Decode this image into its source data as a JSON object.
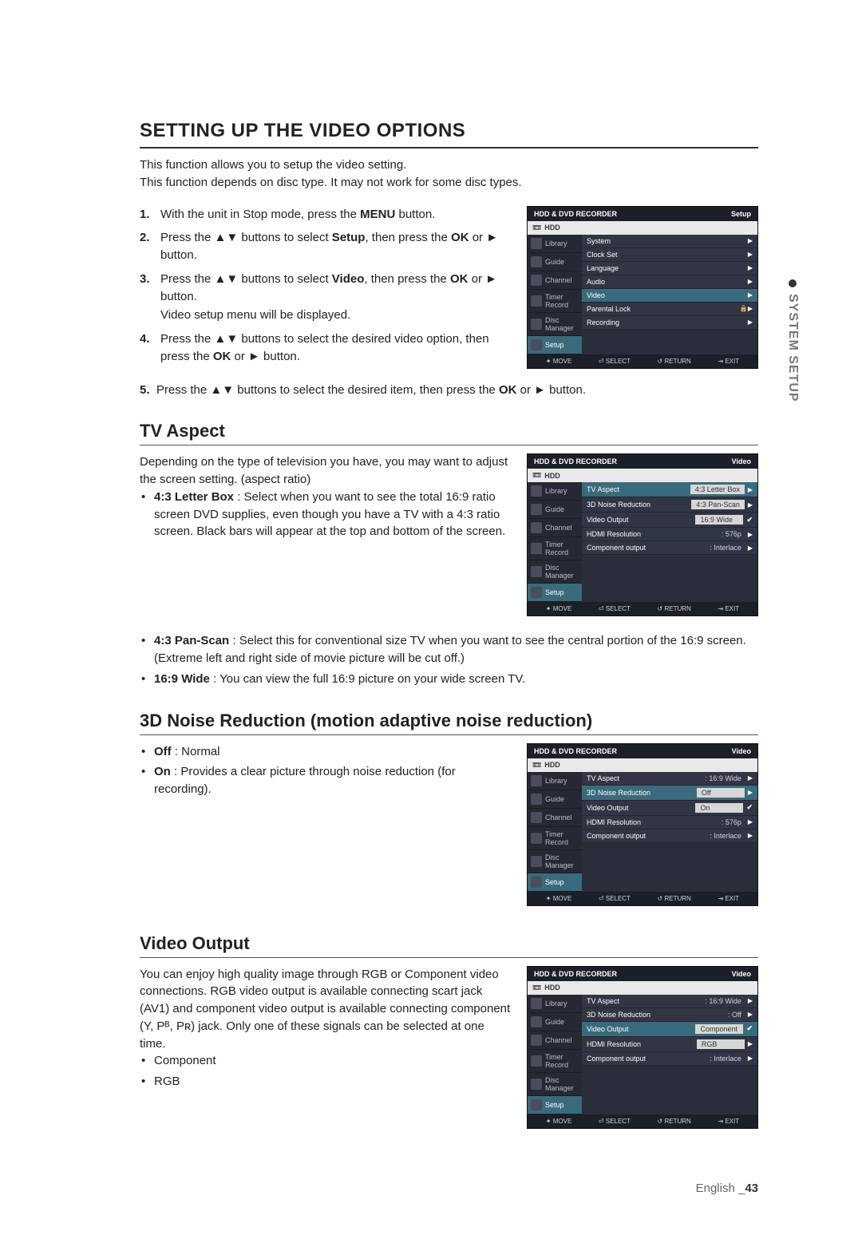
{
  "sideTab": "SYSTEM SETUP",
  "h1": "SETTING UP THE VIDEO OPTIONS",
  "intro1": "This function allows you to setup the video setting.",
  "intro2": "This function depends on disc type. It may not work for some disc types.",
  "steps": {
    "s1a": "With the unit in Stop mode, press the ",
    "s1b": "MENU",
    "s1c": " button.",
    "s2a": "Press the ▲▼ buttons to select ",
    "s2b": "Setup",
    "s2c": ", then press the ",
    "s2d": "OK",
    "s2e": " or ► button.",
    "s3a": "Press the ▲▼ buttons to select ",
    "s3b": "Video",
    "s3c": ", then press the ",
    "s3d": "OK",
    "s3e": " or ► button.",
    "s3sub": "Video setup menu will be displayed.",
    "s4a": "Press the ▲▼ buttons to select the desired video option, then press the ",
    "s4b": "OK",
    "s4c": " or ► button.",
    "s5a": "Press the ▲▼ buttons to select the desired item, then press the ",
    "s5b": "OK",
    "s5c": " or ► button."
  },
  "tvAspect": {
    "title": "TV Aspect",
    "desc": "Depending on the type of television you have, you may want to adjust the screen setting. (aspect ratio)",
    "lb_label": "4:3 Letter Box",
    "lb_text": " : Select when you want to see the total 16:9 ratio screen DVD supplies, even though you have a TV with a 4:3 ratio screen. Black bars will appear at the top and bottom of the screen.",
    "ps_label": "4:3 Pan-Scan",
    "ps_text": " : Select this for conventional size TV when you want to see the central portion of the 16:9 screen. (Extreme left and right side of movie picture will be cut off.)",
    "wide_label": "16:9 Wide",
    "wide_text": " : You can view the full 16:9 picture on your wide screen TV."
  },
  "noise": {
    "title": "3D Noise Reduction (motion adaptive noise reduction)",
    "off_label": "Off",
    "off_text": " : Normal",
    "on_label": "On",
    "on_text": " : Provides a clear picture through noise reduction (for recording)."
  },
  "vout": {
    "title": "Video Output",
    "desc": "You can enjoy high quality image through RGB or Component video connections. RGB video output is available connecting scart jack (AV1) and component video output is available connecting component (Y, Pᴮ, Pʀ) jack. Only one of these signals can be selected at one time.",
    "opt1": "Component",
    "opt2": "RGB"
  },
  "footer": {
    "lang": "English",
    "page": "43"
  },
  "osdCommon": {
    "title": "HDD & DVD RECORDER",
    "sub_icon": "📼",
    "sub": "HDD",
    "side": [
      "Library",
      "Guide",
      "Channel",
      "Timer Record",
      "Disc Manager",
      "Setup"
    ],
    "foot_move": "✦ MOVE",
    "foot_select": "⏎ SELECT",
    "foot_return": "↺ RETURN",
    "foot_exit": "⇥ EXIT"
  },
  "osd1": {
    "corner": "Setup",
    "rows": [
      {
        "lab": "System",
        "type": "arrow"
      },
      {
        "lab": "Clock Set",
        "type": "arrow"
      },
      {
        "lab": "Language",
        "type": "arrow"
      },
      {
        "lab": "Audio",
        "type": "arrow"
      },
      {
        "lab": "Video",
        "type": "arrow",
        "hl": true
      },
      {
        "lab": "Parental Lock",
        "type": "lock"
      },
      {
        "lab": "Recording",
        "type": "arrow"
      }
    ]
  },
  "osd2": {
    "corner": "Video",
    "rows": [
      {
        "lab": "TV Aspect",
        "val": "4:3 Letter Box",
        "box": true,
        "hl": true
      },
      {
        "lab": "3D Noise Reduction",
        "val": "4:3 Pan-Scan",
        "box": true
      },
      {
        "lab": "Video Output",
        "val": "16:9 Wide",
        "box": true,
        "chk": true
      },
      {
        "lab": "HDMI Resolution",
        "val": ": 576p",
        "arrow": true
      },
      {
        "lab": "Component output",
        "val": ": Interlace",
        "arrow": true
      }
    ]
  },
  "osd3": {
    "corner": "Video",
    "rows": [
      {
        "lab": "TV Aspect",
        "val": ": 16:9 Wide",
        "arrow": true
      },
      {
        "lab": "3D Noise Reduction",
        "val": "Off",
        "box": true,
        "hl": true
      },
      {
        "lab": "Video Output",
        "val": "On",
        "box": true,
        "chk": true
      },
      {
        "lab": "HDMI Resolution",
        "val": ": 576p",
        "arrow": true
      },
      {
        "lab": "Component output",
        "val": ": Interlace",
        "arrow": true
      }
    ]
  },
  "osd4": {
    "corner": "Video",
    "rows": [
      {
        "lab": "TV Aspect",
        "val": ": 16:9 Wide",
        "arrow": true
      },
      {
        "lab": "3D Noise Reduction",
        "val": ": Off",
        "arrow": true
      },
      {
        "lab": "Video Output",
        "val": "Component",
        "box": true,
        "hl": true,
        "chk": true
      },
      {
        "lab": "HDMI Resolution",
        "val": "RGB",
        "box": true
      },
      {
        "lab": "Component output",
        "val": ": Interlace",
        "arrow": true
      }
    ]
  }
}
